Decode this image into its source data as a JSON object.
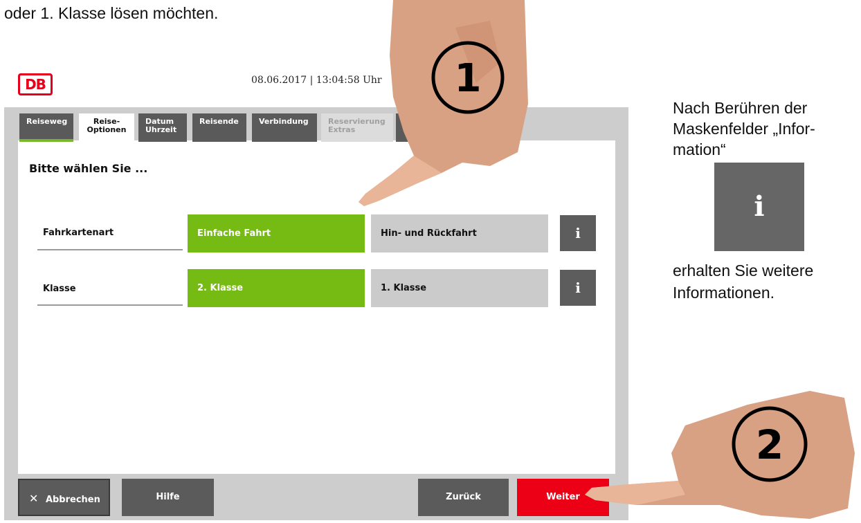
{
  "instruction_top": "oder 1. Klasse lösen möchten.",
  "header": {
    "logo_text": "DB",
    "datetime": "08.06.2017 | 13:04:58 Uhr"
  },
  "tabs": [
    {
      "line1": "Reiseweg",
      "line2": ""
    },
    {
      "line1": "Reise-",
      "line2": "Optionen"
    },
    {
      "line1": "Datum",
      "line2": "Uhrzeit"
    },
    {
      "line1": "Reisende",
      "line2": ""
    },
    {
      "line1": "Verbindung",
      "line2": ""
    },
    {
      "line1": "Reservierung",
      "line2": "Extras"
    }
  ],
  "main": {
    "heading": "Bitte wählen Sie ...",
    "rows": [
      {
        "label": "Fahrkartenart",
        "option_selected": "Einfache Fahrt",
        "option_other": "Hin- und Rückfahrt",
        "info_icon": "i"
      },
      {
        "label": "Klasse",
        "option_selected": "2. Klasse",
        "option_other": "1. Klasse",
        "info_icon": "i"
      }
    ]
  },
  "footer": {
    "cancel_icon": "✕",
    "cancel_label": "Abbrechen",
    "help_label": "Hilfe",
    "back_label": "Zurück",
    "next_label": "Weiter"
  },
  "side": {
    "line1": "Nach Berühren der",
    "line2": "Maskenfelder „Infor-",
    "line3": "mation“",
    "info_icon": "i",
    "line4": "erhalten Sie weitere",
    "line5": "Informationen."
  },
  "annotations": {
    "step1": "1",
    "step2": "2"
  },
  "colors": {
    "green": "#76bb14",
    "red": "#ec0016",
    "dark_gray": "#5b5b5b",
    "db_red": "#e3001b"
  }
}
